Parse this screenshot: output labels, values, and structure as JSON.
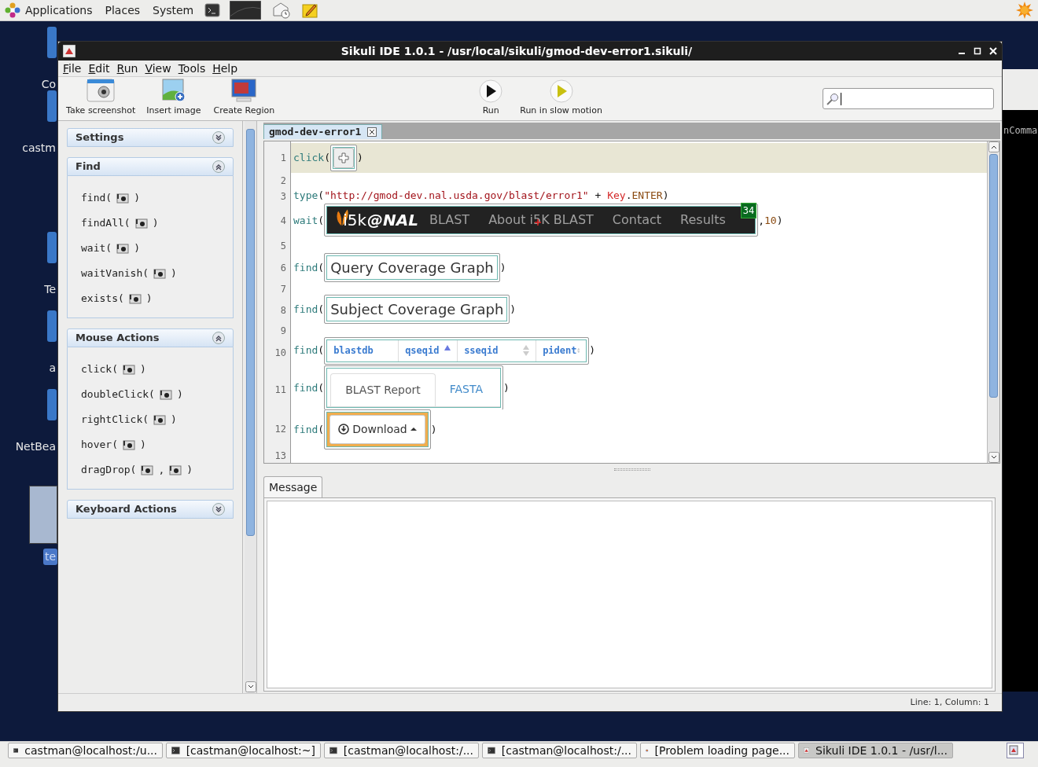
{
  "top_panel": {
    "menus": [
      "Applications",
      "Places",
      "System"
    ]
  },
  "desktop_icons": [
    {
      "label": "Co",
      "selected": false
    },
    {
      "label": "castm",
      "selected": false
    },
    {
      "label": "Te",
      "selected": false
    },
    {
      "label": "a",
      "selected": false
    },
    {
      "label": "NetBea",
      "selected": false
    },
    {
      "label": "te",
      "selected": true
    }
  ],
  "background_window": {
    "text": "nComma"
  },
  "window": {
    "title": "Sikuli IDE 1.0.1 - /usr/local/sikuli/gmod-dev-error1.sikuli/",
    "menu": [
      "File",
      "Edit",
      "Run",
      "View",
      "Tools",
      "Help"
    ],
    "toolbar": [
      {
        "kind": "screenshot",
        "label": "Take screenshot"
      },
      {
        "kind": "insert-image",
        "label": "Insert image"
      },
      {
        "kind": "region",
        "label": "Create Region"
      },
      {
        "kind": "run",
        "label": "Run"
      },
      {
        "kind": "slow-run",
        "label": "Run in slow motion"
      }
    ],
    "sidebar": {
      "sections": [
        {
          "title": "Settings",
          "expanded": false
        },
        {
          "title": "Find",
          "expanded": true,
          "items": [
            {
              "parts": [
                "find(",
                ")"
              ]
            },
            {
              "parts": [
                "findAll(",
                ")"
              ]
            },
            {
              "parts": [
                "wait(",
                ")"
              ]
            },
            {
              "parts": [
                "waitVanish(",
                ")"
              ]
            },
            {
              "parts": [
                "exists(",
                ")"
              ]
            }
          ]
        },
        {
          "title": "Mouse Actions",
          "expanded": true,
          "items": [
            {
              "parts": [
                "click(",
                ")"
              ]
            },
            {
              "parts": [
                "doubleClick(",
                ")"
              ]
            },
            {
              "parts": [
                "rightClick(",
                ")"
              ]
            },
            {
              "parts": [
                "hover(",
                ")"
              ]
            },
            {
              "parts": [
                "dragDrop(",
                ",",
                ")"
              ]
            }
          ]
        },
        {
          "title": "Keyboard Actions",
          "expanded": false
        }
      ]
    },
    "editor": {
      "tabs": [
        {
          "label": "gmod-dev-error1",
          "selected": true
        }
      ],
      "lines": [
        {
          "number": "1",
          "current": true,
          "segments": [
            {
              "kind": "fn",
              "text": "click"
            },
            {
              "kind": "punct",
              "text": "("
            },
            {
              "kind": "image",
              "image": {
                "kind": "target"
              }
            },
            {
              "kind": "punct",
              "text": ")"
            }
          ]
        },
        {
          "number": "2",
          "current": false
        },
        {
          "number": "3",
          "current": false,
          "segments": [
            {
              "kind": "fn",
              "text": "type"
            },
            {
              "kind": "punct",
              "text": "("
            },
            {
              "kind": "string",
              "text": "\"http://gmod-dev.nal.usda.gov/blast/error1\""
            },
            {
              "kind": "punct",
              "text": " + "
            },
            {
              "kind": "key",
              "text": "Key"
            },
            {
              "kind": "punct",
              "text": "."
            },
            {
              "kind": "const",
              "text": "ENTER"
            },
            {
              "kind": "punct",
              "text": ")"
            }
          ]
        },
        {
          "number": "4",
          "current": false,
          "segments": [
            {
              "kind": "fn",
              "text": "wait"
            },
            {
              "kind": "punct",
              "text": "("
            },
            {
              "kind": "image",
              "image": {
                "kind": "navbar",
                "logo": "i5k",
                "brand": "@NAL",
                "links": [
                  "BLAST",
                  "About i5K BLAST",
                  "Contact",
                  "Results"
                ],
                "badge": "34"
              }
            },
            {
              "kind": "punct",
              "text": ","
            },
            {
              "kind": "const",
              "text": "10"
            },
            {
              "kind": "punct",
              "text": ")"
            }
          ]
        },
        {
          "number": "5",
          "current": false
        },
        {
          "number": "6",
          "current": false,
          "segments": [
            {
              "kind": "fn",
              "text": "find"
            },
            {
              "kind": "punct",
              "text": "("
            },
            {
              "kind": "image",
              "image": {
                "kind": "label",
                "text": "Query Coverage Graph"
              }
            },
            {
              "kind": "punct",
              "text": ")"
            }
          ]
        },
        {
          "number": "7",
          "current": false
        },
        {
          "number": "8",
          "current": false,
          "segments": [
            {
              "kind": "fn",
              "text": "find"
            },
            {
              "kind": "punct",
              "text": "("
            },
            {
              "kind": "image",
              "image": {
                "kind": "label",
                "text": "Subject Coverage Graph"
              }
            },
            {
              "kind": "punct",
              "text": ")"
            }
          ]
        },
        {
          "number": "9",
          "current": false
        },
        {
          "number": "10",
          "current": false,
          "segments": [
            {
              "kind": "fn",
              "text": "find"
            },
            {
              "kind": "punct",
              "text": "("
            },
            {
              "kind": "image",
              "image": {
                "kind": "table-header",
                "columns": [
                  {
                    "label": "blastdb",
                    "sortable": false,
                    "sorted": false
                  },
                  {
                    "label": "qseqid",
                    "sortable": true,
                    "sorted": true
                  },
                  {
                    "label": "sseqid",
                    "sortable": true,
                    "sorted": false
                  },
                  {
                    "label": "pident",
                    "sortable": true,
                    "sorted": false
                  }
                ]
              }
            },
            {
              "kind": "punct",
              "text": ")"
            }
          ]
        },
        {
          "number": "11",
          "current": false,
          "segments": [
            {
              "kind": "fn",
              "text": "find"
            },
            {
              "kind": "punct",
              "text": "("
            },
            {
              "kind": "image",
              "image": {
                "kind": "tabs",
                "items": [
                  {
                    "label": "BLAST Report",
                    "selected": true
                  },
                  {
                    "label": "FASTA",
                    "selected": false
                  }
                ]
              }
            },
            {
              "kind": "punct",
              "text": ")"
            }
          ]
        },
        {
          "number": "12",
          "current": false,
          "segments": [
            {
              "kind": "fn",
              "text": "find"
            },
            {
              "kind": "punct",
              "text": "("
            },
            {
              "kind": "image",
              "image": {
                "kind": "dropdown-button",
                "label": "Download",
                "highlighted": true
              }
            },
            {
              "kind": "punct",
              "text": ")"
            }
          ]
        },
        {
          "number": "13",
          "current": false
        }
      ]
    },
    "message_panel": {
      "tabs": [
        {
          "label": "Message",
          "selected": true
        }
      ]
    },
    "status_bar": "Line: 1, Column: 1"
  },
  "taskbar": [
    {
      "kind": "terminal",
      "label": "castman@localhost:/u...",
      "selected": false
    },
    {
      "kind": "terminal",
      "label": "[castman@localhost:~]",
      "selected": false
    },
    {
      "kind": "terminal",
      "label": "[castman@localhost:/...",
      "selected": false
    },
    {
      "kind": "terminal",
      "label": "[castman@localhost:/...",
      "selected": false
    },
    {
      "kind": "browser",
      "label": "[Problem loading page...",
      "selected": false
    },
    {
      "kind": "app",
      "label": "Sikuli IDE 1.0.1 - /usr/l...",
      "selected": true
    }
  ]
}
